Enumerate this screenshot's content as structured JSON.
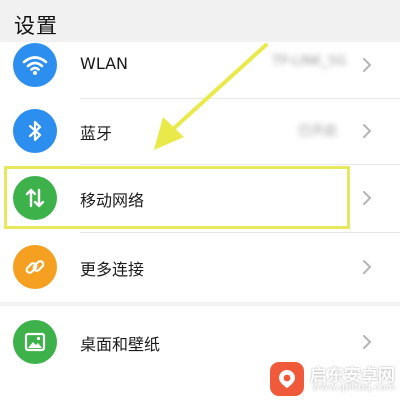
{
  "page_title": "设置",
  "settings": [
    {
      "label": "WLAN",
      "value": "TP-LINK_5G",
      "icon": "wifi-icon",
      "color": "#2c8ff0"
    },
    {
      "label": "蓝牙",
      "value": "已开启",
      "icon": "bluetooth-icon",
      "color": "#2c8ff0"
    },
    {
      "label": "移动网络",
      "value": "",
      "icon": "mobile-data-icon",
      "color": "#3db14a"
    },
    {
      "label": "更多连接",
      "value": "",
      "icon": "link-icon",
      "color": "#f5a021"
    },
    {
      "label": "桌面和壁纸",
      "value": "",
      "icon": "image-icon",
      "color": "#3db14a"
    }
  ],
  "annotation": {
    "highlight_color": "#e7e85d",
    "arrow_color": "#e9ea4a"
  },
  "watermark": {
    "name": "启东安卓网",
    "url": "www.qdltdq.com",
    "color": "#ef5b3a"
  }
}
